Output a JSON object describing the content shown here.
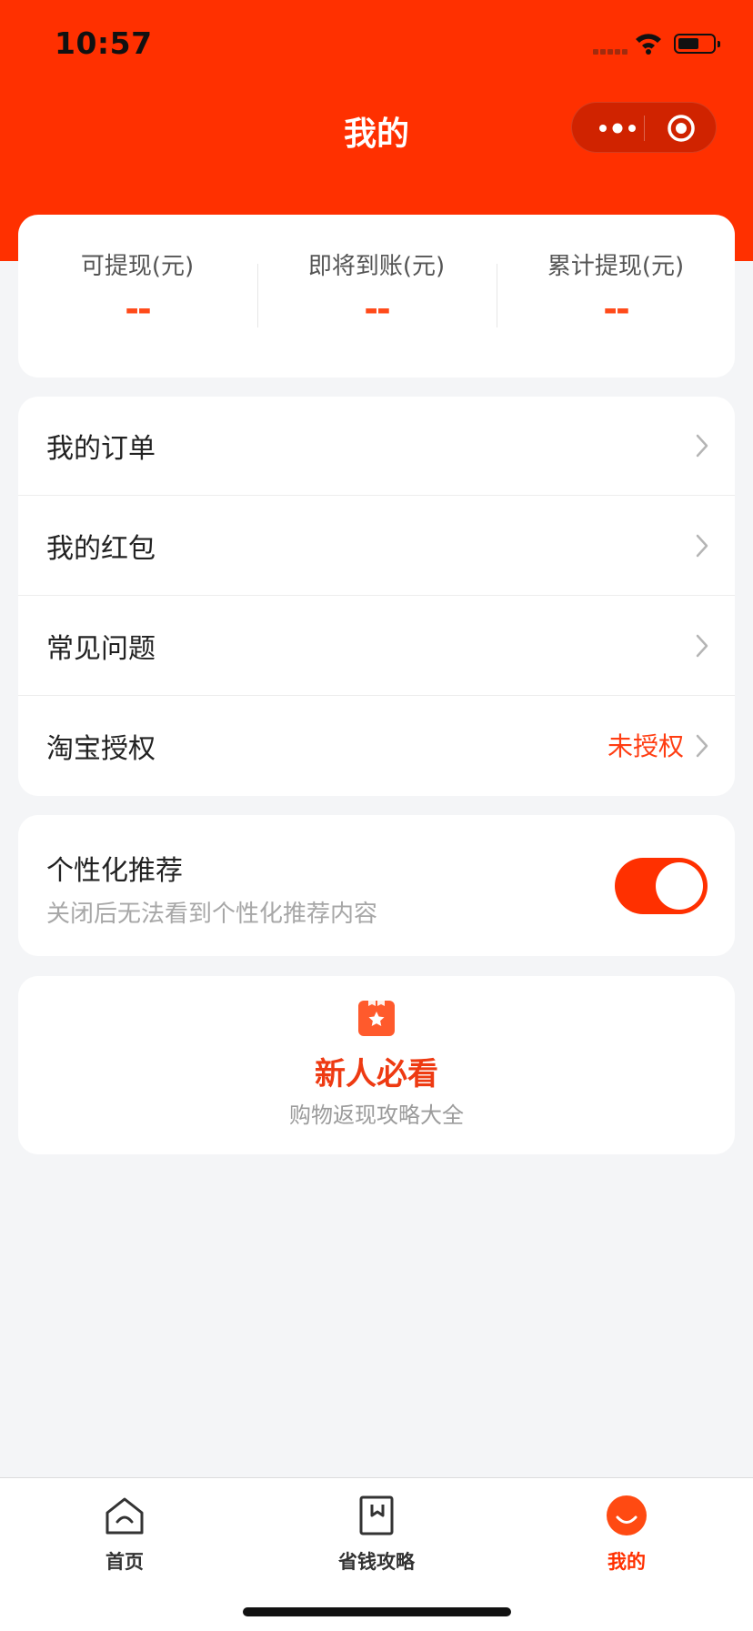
{
  "status_bar": {
    "time": "10:57"
  },
  "nav": {
    "title": "我的"
  },
  "stats": [
    {
      "label": "可提现(元)",
      "value": "--"
    },
    {
      "label": "即将到账(元)",
      "value": "--"
    },
    {
      "label": "累计提现(元)",
      "value": "--"
    }
  ],
  "menu": [
    {
      "label": "我的订单"
    },
    {
      "label": "我的红包"
    },
    {
      "label": "常见问题"
    },
    {
      "label": "淘宝授权",
      "status": "未授权"
    }
  ],
  "personalization": {
    "title": "个性化推荐",
    "subtitle": "关闭后无法看到个性化推荐内容",
    "enabled": true
  },
  "guide": {
    "title": "新人必看",
    "subtitle": "购物返现攻略大全",
    "icon": "star-bookmark-icon"
  },
  "tabbar": [
    {
      "label": "首页",
      "icon": "home-icon",
      "active": false
    },
    {
      "label": "省钱攻略",
      "icon": "book-icon",
      "active": false
    },
    {
      "label": "我的",
      "icon": "smile-icon",
      "active": true
    }
  ],
  "colors": {
    "brand": "#ff3000",
    "accent_text": "#ff3d12",
    "background": "#f4f5f7"
  }
}
